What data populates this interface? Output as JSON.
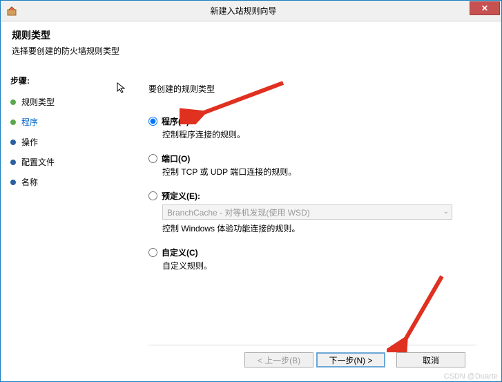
{
  "window": {
    "title": "新建入站规则向导"
  },
  "header": {
    "title": "规则类型",
    "subtitle": "选择要创建的防火墙规则类型"
  },
  "sidebar": {
    "steps_label": "步骤:",
    "items": [
      {
        "label": "规则类型",
        "color": "#5aa84c",
        "text_color": "#000000"
      },
      {
        "label": "程序",
        "color": "#5aa84c",
        "text_color": "#0066cc"
      },
      {
        "label": "操作",
        "color": "#2a5fa0",
        "text_color": "#000000"
      },
      {
        "label": "配置文件",
        "color": "#2a5fa0",
        "text_color": "#000000"
      },
      {
        "label": "名称",
        "color": "#2a5fa0",
        "text_color": "#000000"
      }
    ]
  },
  "main": {
    "title": "要创建的规则类型",
    "options": [
      {
        "label": "程序(P)",
        "desc": "控制程序连接的规则。",
        "selected": true
      },
      {
        "label": "端口(O)",
        "desc": "控制 TCP 或 UDP 端口连接的规则。",
        "selected": false
      },
      {
        "label": "预定义(E):",
        "desc": "控制 Windows 体验功能连接的规则。",
        "selected": false,
        "combo": "BranchCache - 对等机发现(使用 WSD)"
      },
      {
        "label": "自定义(C)",
        "desc": "自定义规则。",
        "selected": false
      }
    ]
  },
  "footer": {
    "back": "< 上一步(B)",
    "next": "下一步(N) >",
    "cancel": "取消"
  },
  "watermark": "CSDN @Duarte"
}
